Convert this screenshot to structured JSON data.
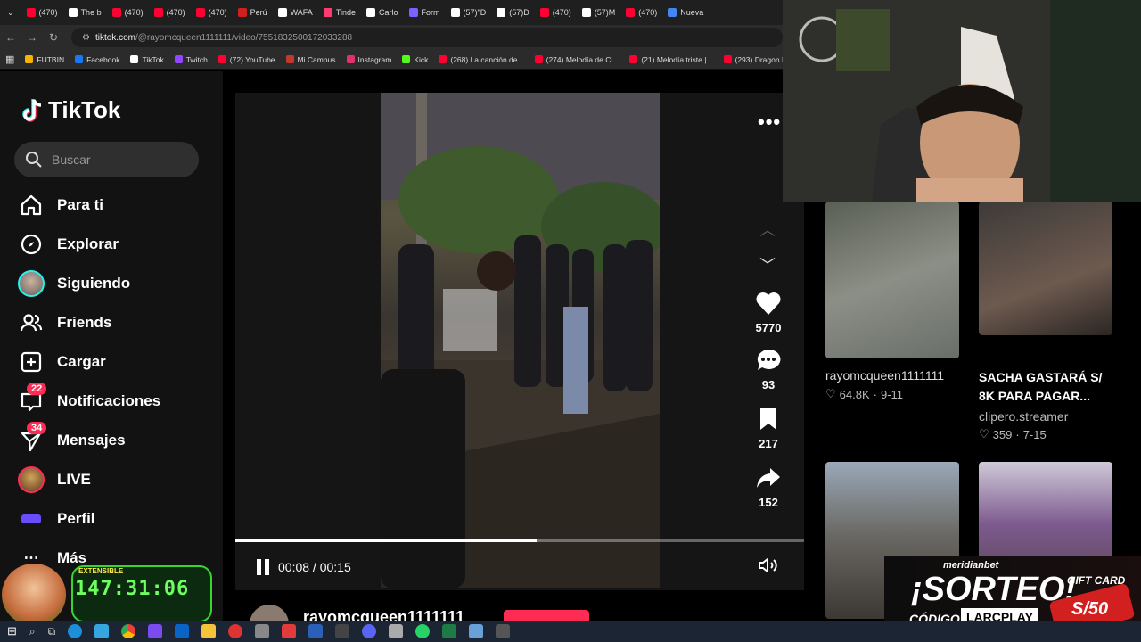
{
  "browser": {
    "tabs": [
      "(470)",
      "The b",
      "(470)",
      "(470)",
      "(470)",
      "Perú",
      "WAFA",
      "Tinde",
      "Carlo",
      "Form",
      "(57)\"D",
      "(57)D",
      "(470)",
      "(57)M",
      "(470)",
      "Nueva"
    ],
    "url_host": "tiktok.com",
    "url_path": "/@rayomcqueen1111111/video/7551832500172033288",
    "bookmarks": [
      "FUTBIN",
      "Facebook",
      "TikTok",
      "Twitch",
      "(72) YouTube",
      "Mi Campus",
      "Instagram",
      "Kick",
      "(268) La canción de...",
      "(274) Melodía de Cl...",
      "(21) Melodía triste |...",
      "(293) Dragon Ball E..."
    ]
  },
  "sidebar": {
    "logo": "TikTok",
    "search_placeholder": "Buscar",
    "items": [
      {
        "label": "Para ti"
      },
      {
        "label": "Explorar"
      },
      {
        "label": "Siguiendo"
      },
      {
        "label": "Friends"
      },
      {
        "label": "Cargar"
      },
      {
        "label": "Notificaciones",
        "badge": "22"
      },
      {
        "label": "Mensajes",
        "badge": "34"
      },
      {
        "label": "LIVE"
      },
      {
        "label": "Perfil"
      },
      {
        "label": "Más"
      }
    ]
  },
  "video": {
    "current_time": "00:08",
    "duration": "00:15",
    "time_display": "00:08 / 00:15",
    "progress": 0.53,
    "author": "rayomcqueen1111111"
  },
  "actions": {
    "likes": "5770",
    "comments": "93",
    "saves": "217",
    "shares": "152"
  },
  "recommendations": [
    {
      "title": "rayomcqueen1111111",
      "likes": "64.8K",
      "date": "9-11"
    },
    {
      "title": "SACHA GASTARÁ S/ 8K PARA PAGAR...",
      "author": "clipero.streamer",
      "likes": "359",
      "date": "7-15"
    }
  ],
  "overlay": {
    "timer": "147:31:06",
    "timer_tag": "EXTENSIBLE",
    "promo_brand": "meridianbet",
    "promo_title": "¡SORTEO!",
    "promo_code_label": "CÓDIGO:",
    "promo_code": "LARCPLAY",
    "gift_card": "GIFT CARD",
    "gift_amount": "S/50"
  },
  "colors": {
    "accent": "#fe2c55",
    "timer_green": "#6dff5e"
  }
}
